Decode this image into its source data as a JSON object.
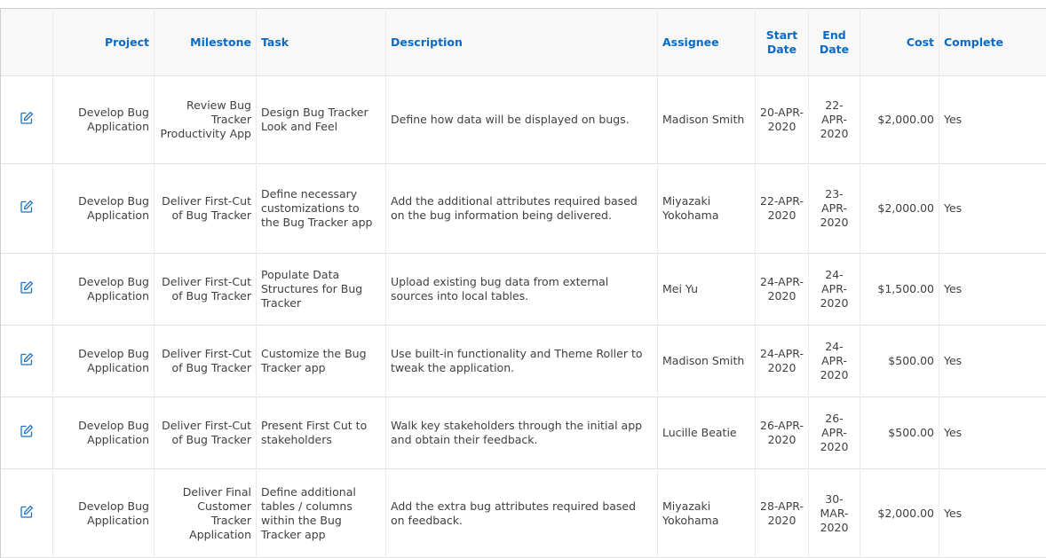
{
  "table": {
    "columns": {
      "edit": "",
      "project": "Project",
      "milestone": "Milestone",
      "task": "Task",
      "description": "Description",
      "assignee": "Assignee",
      "start_date": "Start Date",
      "end_date": "End Date",
      "cost": "Cost",
      "complete": "Complete"
    },
    "rows": [
      {
        "project": "Develop Bug Application",
        "milestone": "Review Bug Tracker Productivity App",
        "task": "Design Bug Tracker Look and Feel",
        "description": "Define how data will be displayed on bugs.",
        "assignee": "Madison Smith",
        "start_date": "20-APR-2020",
        "end_date": "22-APR-2020",
        "cost": "$2,000.00",
        "complete": "Yes"
      },
      {
        "project": "Develop Bug Application",
        "milestone": "Deliver First-Cut of Bug Tracker",
        "task": "Define necessary customizations to the Bug Tracker app",
        "description": "Add the additional attributes required based on the bug information being delivered.",
        "assignee": "Miyazaki Yokohama",
        "start_date": "22-APR-2020",
        "end_date": "23-APR-2020",
        "cost": "$2,000.00",
        "complete": "Yes"
      },
      {
        "project": "Develop Bug Application",
        "milestone": "Deliver First-Cut of Bug Tracker",
        "task": "Populate Data Structures for Bug Tracker",
        "description": "Upload existing bug data from external sources into local tables.",
        "assignee": "Mei Yu",
        "start_date": "24-APR-2020",
        "end_date": "24-APR-2020",
        "cost": "$1,500.00",
        "complete": "Yes"
      },
      {
        "project": "Develop Bug Application",
        "milestone": "Deliver First-Cut of Bug Tracker",
        "task": "Customize the Bug Tracker app",
        "description": "Use built-in functionality and Theme Roller to tweak the application.",
        "assignee": "Madison Smith",
        "start_date": "24-APR-2020",
        "end_date": "24-APR-2020",
        "cost": "$500.00",
        "complete": "Yes"
      },
      {
        "project": "Develop Bug Application",
        "milestone": "Deliver First-Cut of Bug Tracker",
        "task": "Present First Cut to stakeholders",
        "description": "Walk key stakeholders through the initial app and obtain their feedback.",
        "assignee": "Lucille Beatie",
        "start_date": "26-APR-2020",
        "end_date": "26-APR-2020",
        "cost": "$500.00",
        "complete": "Yes"
      },
      {
        "project": "Develop Bug Application",
        "milestone": "Deliver Final Customer Tracker Application",
        "task": "Define additional tables / columns within the Bug Tracker app",
        "description": "Add the extra bug attributes required based on feedback.",
        "assignee": "Miyazaki Yokohama",
        "start_date": "28-APR-2020",
        "end_date": "30-MAR-2020",
        "cost": "$2,000.00",
        "complete": "Yes"
      }
    ]
  },
  "icons": {
    "edit": "pencil-square-icon"
  },
  "colors": {
    "header_text": "#0a6ac4",
    "header_bg": "#f8f8f8",
    "body_text": "#404040",
    "edit_icon": "#1a73c9"
  }
}
